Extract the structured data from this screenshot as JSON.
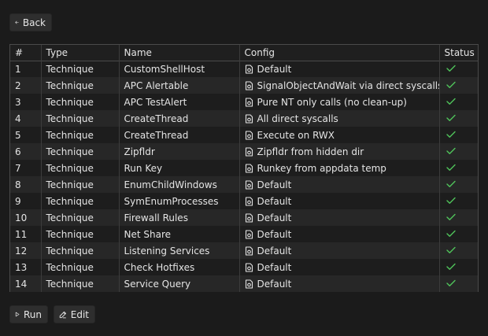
{
  "back_label": "Back",
  "run_label": "Run",
  "edit_label": "Edit",
  "columns": [
    "#",
    "Type",
    "Name",
    "Config",
    "Status"
  ],
  "rows": [
    {
      "num": "1",
      "type": "Technique",
      "name": "CustomShellHost",
      "config": "Default",
      "status": "ok"
    },
    {
      "num": "2",
      "type": "Technique",
      "name": "APC Alertable",
      "config": "SignalObjectAndWait via direct syscalls",
      "status": "ok"
    },
    {
      "num": "3",
      "type": "Technique",
      "name": "APC TestAlert",
      "config": "Pure NT only calls (no clean-up)",
      "status": "ok"
    },
    {
      "num": "4",
      "type": "Technique",
      "name": "CreateThread",
      "config": "All direct syscalls",
      "status": "ok"
    },
    {
      "num": "5",
      "type": "Technique",
      "name": "CreateThread",
      "config": "Execute on RWX",
      "status": "ok"
    },
    {
      "num": "6",
      "type": "Technique",
      "name": "Zipfldr",
      "config": "Zipfldr from hidden dir",
      "status": "ok"
    },
    {
      "num": "7",
      "type": "Technique",
      "name": "Run Key",
      "config": "Runkey from appdata temp",
      "status": "ok"
    },
    {
      "num": "8",
      "type": "Technique",
      "name": "EnumChildWindows",
      "config": "Default",
      "status": "ok"
    },
    {
      "num": "9",
      "type": "Technique",
      "name": "SymEnumProcesses",
      "config": "Default",
      "status": "ok"
    },
    {
      "num": "10",
      "type": "Technique",
      "name": "Firewall Rules",
      "config": "Default",
      "status": "ok"
    },
    {
      "num": "11",
      "type": "Technique",
      "name": "Net Share",
      "config": "Default",
      "status": "ok"
    },
    {
      "num": "12",
      "type": "Technique",
      "name": "Listening Services",
      "config": "Default",
      "status": "ok"
    },
    {
      "num": "13",
      "type": "Technique",
      "name": "Check Hotfixes",
      "config": "Default",
      "status": "ok"
    },
    {
      "num": "14",
      "type": "Technique",
      "name": "Service Query",
      "config": "Default",
      "status": "ok"
    }
  ],
  "icons": {
    "back": "arrow-left-icon",
    "config": "file-settings-icon",
    "status_ok": "check-icon",
    "run": "play-icon",
    "edit": "pencil-icon"
  },
  "colors": {
    "status_ok": "#4fc35a"
  }
}
